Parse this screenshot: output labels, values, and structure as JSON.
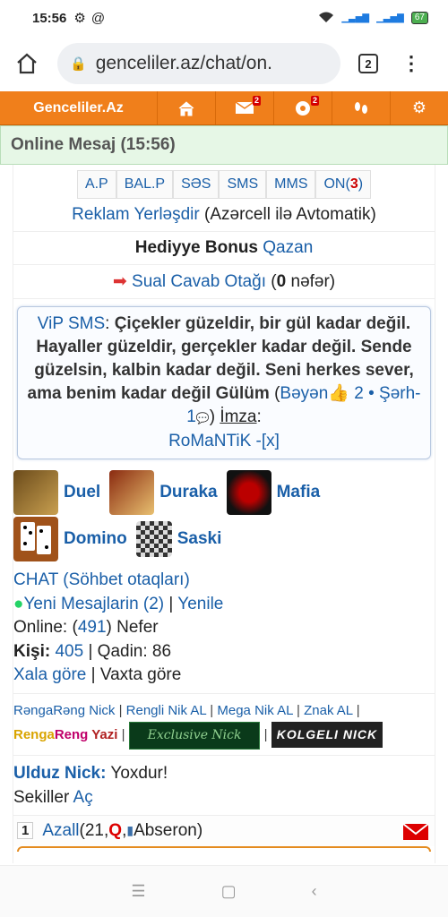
{
  "status": {
    "time": "15:56",
    "battery": "67"
  },
  "browser": {
    "url": "genceliler.az/chat/on.",
    "tab_count": "2"
  },
  "nav": {
    "logo": "Genceliler.Az",
    "mail_badge": "2",
    "alerts_badge": "2"
  },
  "header": {
    "title": "Online Mesaj (15:56)"
  },
  "menu": {
    "ap": "A.P",
    "balp": "BAL.P",
    "ses": "SƏS",
    "sms": "SMS",
    "mms": "MMS",
    "on": "ON(",
    "on_count": "3",
    "on_close": ")"
  },
  "ad": {
    "link": "Reklam Yerləşdir",
    "text": " (Azərcell ilə Avtomatik)"
  },
  "bonus": {
    "text": "Hediyye Bonus ",
    "link": "Qazan"
  },
  "quiz": {
    "arrow": "➡",
    "link": "Sual Cavab Otağı",
    "open": " (",
    "count": "0",
    "close": " nəfər)"
  },
  "vip": {
    "label": "ViP SMS",
    "colon": ": ",
    "message": "Çiçekler güzeldir, bir gül kadar değil. Hayaller güzeldir, gerçekler kadar değil. Sende güzelsin, kalbin kadar değil. Seni herkes sever, ama benim kadar değil Gülüm",
    "like_open": " (",
    "like_link": "Bəyən",
    "like_count": " 2 • ",
    "comment_link": "Şərh-1",
    "like_close": ") ",
    "sign_label": "İmza",
    "sign_colon": ":",
    "signature": "RoMaNTiK",
    "close_link": " -[x]"
  },
  "games": {
    "duel": "Duel",
    "duraka": "Duraka",
    "mafia": "Mafia",
    "domino": "Domino",
    "saski": "Saski"
  },
  "chat": {
    "rooms_link": "CHAT (Söhbet otaqları)",
    "new_messages": "Yeni Mesajlarin (2)",
    "sep": " | ",
    "refresh": "Yenile",
    "online_label": "Online: (",
    "online_count": "491",
    "online_suffix": ") Nefer",
    "male_label": "Kişi:",
    "male_count": " 405",
    "female": " | Qadin: 86",
    "sort_place": "Xala göre",
    "sort_time": " | Vaxta göre"
  },
  "nicks": {
    "rengarang": "RəngaRəng Nick",
    "rengli": "Rengli Nik AL",
    "mega": "Mega Nik AL",
    "znak": "Znak AL",
    "yazi_a": "Renga",
    "yazi_b": "Reng",
    "yazi_c": " Yazi",
    "exclusive": "Exclusive Nick",
    "kolgeli": "KOLGELI NICK"
  },
  "star": {
    "label": "Ulduz Nick:",
    "value": " Yoxdur!",
    "pics": "Sekiller ",
    "pics_link": "Aç"
  },
  "user": {
    "rank": "1",
    "name": "Azall",
    "open": " (21,",
    "gender": "Q",
    "comma": ", ",
    "city": " Abseron)"
  },
  "colors": {
    "nav_orange": "#f07f1b",
    "link_blue": "#1a5fa8",
    "header_green": "#e6f7e6"
  }
}
